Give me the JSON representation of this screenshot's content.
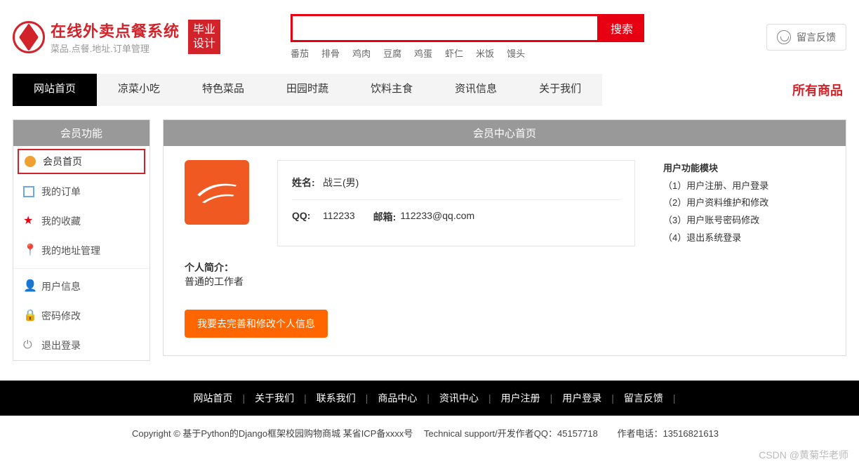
{
  "header": {
    "title": "在线外卖点餐系统",
    "subtitle": "菜品.点餐.地址.订单管理",
    "badge_l1": "毕业",
    "badge_l2": "设计",
    "search_btn": "搜索",
    "hot": [
      "番茄",
      "排骨",
      "鸡肉",
      "豆腐",
      "鸡蛋",
      "虾仁",
      "米饭",
      "馒头"
    ],
    "feedback": "留言反馈"
  },
  "nav": {
    "items": [
      "网站首页",
      "凉菜小吃",
      "特色菜品",
      "田园时蔬",
      "饮料主食",
      "资讯信息",
      "关于我们"
    ],
    "active": 0,
    "right": "所有商品"
  },
  "sidebar": {
    "title": "会员功能",
    "items": [
      {
        "label": "会员首页",
        "icon": "home"
      },
      {
        "label": "我的订单",
        "icon": "order"
      },
      {
        "label": "我的收藏",
        "icon": "star"
      },
      {
        "label": "我的地址管理",
        "icon": "loc"
      },
      {
        "label": "用户信息",
        "icon": "user"
      },
      {
        "label": "密码修改",
        "icon": "lock"
      },
      {
        "label": "退出登录",
        "icon": "exit"
      }
    ],
    "active": 0
  },
  "main": {
    "title": "会员中心首页",
    "name_lbl": "姓名:",
    "name_val": "战三(男)",
    "qq_lbl": "QQ:",
    "qq_val": "112233",
    "email_lbl": "邮箱:",
    "email_val": "112233@qq.com",
    "bio_lbl": "个人简介：",
    "bio_val": "普通的工作者",
    "edit_btn": "我要去完善和修改个人信息",
    "module_title": "用户功能模块",
    "modules": [
      "（1）用户注册、用户登录",
      "（2）用户资料维护和修改",
      "（3）用户账号密码修改",
      "（4）退出系统登录"
    ]
  },
  "footer": {
    "links": [
      "网站首页",
      "关于我们",
      "联系我们",
      "商品中心",
      "资讯中心",
      "用户注册",
      "用户登录",
      "留言反馈"
    ],
    "copy_prefix": "Copyright © 基于Python的Django框架校园购物商城 某省ICP备xxxx号",
    "tech": "Technical support/开发作者QQ：45157718",
    "author": "作者电话：13516821613"
  },
  "watermark": "CSDN @黄菊华老师"
}
